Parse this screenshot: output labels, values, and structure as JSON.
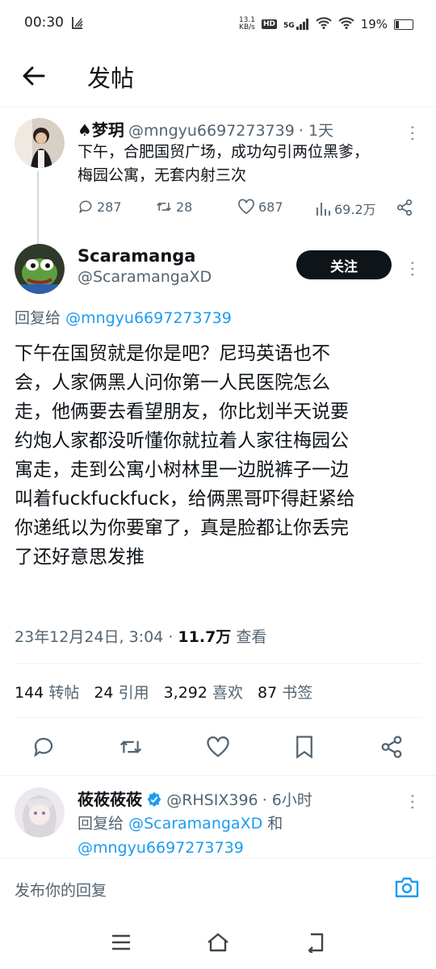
{
  "status_bar": {
    "time": "00:30",
    "net_speed_top": "13.1",
    "net_speed_bottom": "KB/s",
    "hd": "HD",
    "signal_label": "5G",
    "battery": "19%"
  },
  "header": {
    "title": "发帖"
  },
  "parent_tweet": {
    "name": "♠梦玥",
    "handle": "@mngyu6697273739",
    "time": "· 1天",
    "text_line1": "下午，合肥国贸广场，成功勾引两位黑爹，",
    "text_line2": "梅园公寓，无套内射三次",
    "replies": "287",
    "retweets": "28",
    "likes": "687",
    "views": "69.2万"
  },
  "main_tweet": {
    "name": "Scaramanga",
    "handle": "@ScaramangaXD",
    "follow_label": "关注",
    "reply_prefix": "回复给",
    "reply_handle": "@mngyu6697273739",
    "text_lines": [
      "下午在国贸就是你是吧？尼玛英语也不",
      "会，人家俩黑人问你第一人民医院怎么",
      "走，他俩要去看望朋友，你比划半天说要",
      "约炮人家都没听懂你就拉着人家往梅园公",
      "寓走，走到公寓小树林里一边脱裤子一边",
      "叫着fuckfuckfuck，给俩黑哥吓得赶紧给",
      "你递纸以为你要窜了，真是脸都让你丢完",
      "了还好意思发推"
    ],
    "datetime": "23年12月24日, 3:04 ·",
    "views_count": "11.7万",
    "views_label": "查看",
    "stats": {
      "retweets_num": "144",
      "retweets_label": "转帖",
      "quotes_num": "24",
      "quotes_label": "引用",
      "likes_num": "3,292",
      "likes_label": "喜欢",
      "bookmarks_num": "87",
      "bookmarks_label": "书签"
    }
  },
  "reply_tweet": {
    "name": "莜莜莜莜",
    "handle": "@RHSIX396",
    "time": "· 6小时",
    "reply_prefix": "回复给",
    "reply_handle1": "@ScaramangaXD",
    "reply_and": "和",
    "reply_handle2": "@mngyu6697273739"
  },
  "reply_input": {
    "placeholder": "发布你的回复"
  },
  "colors": {
    "accent": "#1d9bf0",
    "text": "#0f1419",
    "muted": "#536471",
    "verified": "#1d9bf0"
  }
}
